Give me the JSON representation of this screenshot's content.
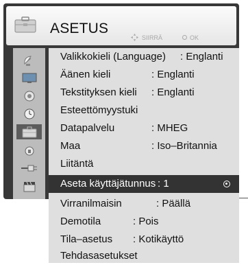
{
  "menu": {
    "title": "ASETUS",
    "hint_move": "SIIRRÄ",
    "hint_ok": "OK"
  },
  "sidebar": {
    "icons": [
      "satellite-dish-icon",
      "monitor-icon",
      "speaker-icon",
      "clock-icon",
      "briefcase-icon",
      "lock-icon",
      "input-plug-icon",
      "clapperboard-icon"
    ],
    "selected": 4
  },
  "rows": [
    {
      "label": "Valikkokieli (Language)",
      "value": ": Englanti"
    },
    {
      "label": "Äänen kieli",
      "value": ": Englanti"
    },
    {
      "label": "Tekstityksen kieli",
      "value": ": Englanti"
    },
    {
      "label": "Esteettömyystuki",
      "value": ""
    },
    {
      "label": "Datapalvelu",
      "value": ": MHEG"
    },
    {
      "label": "Maa",
      "value": ": Iso–Britannia"
    },
    {
      "label": "Liitäntä",
      "value": ""
    },
    {
      "label": "Aseta käyttäjätunnus",
      "value": ": 1"
    },
    {
      "label": "Virranilmaisin",
      "value": ": Päällä"
    },
    {
      "label": "Demotila",
      "value": ": Pois"
    },
    {
      "label": "Tila–asetus",
      "value": ": Kotikäyttö"
    },
    {
      "label": "Tehdasasetukset",
      "value": ""
    }
  ],
  "highlighted_row": 7,
  "colors": {
    "frame": "#383838",
    "highlight": "#333333",
    "panel": "#dfdfdf",
    "sidebar": "#bcbcbc"
  }
}
